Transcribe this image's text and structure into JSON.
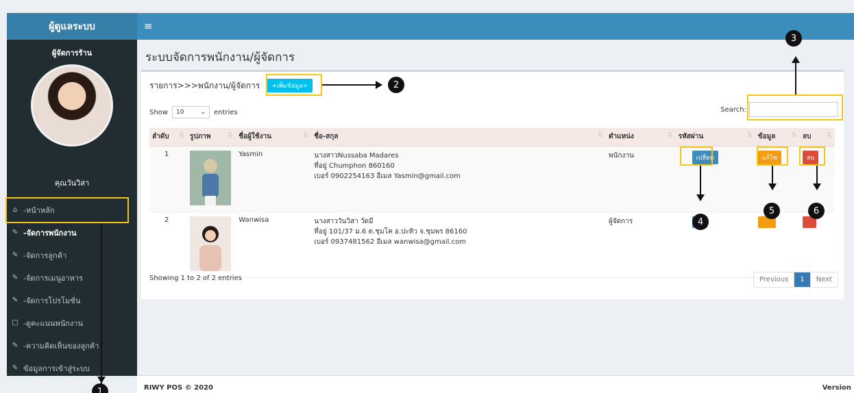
{
  "sidebar": {
    "brand": "ผู้ดูแลระบบ",
    "role": "ผู้จัดการร้าน",
    "user_name": "คุณวันวิสา",
    "items": [
      {
        "label": "-หน้าหลัก",
        "icon": "home-icon"
      },
      {
        "label": "-จัดการพนักงาน",
        "icon": "edit-icon"
      },
      {
        "label": "-จัดการลูกค้า",
        "icon": "edit-icon"
      },
      {
        "label": "-จัดการเมนูอาหาร",
        "icon": "edit-icon"
      },
      {
        "label": "-จัดการโปรโมชั่น",
        "icon": "edit-icon"
      },
      {
        "label": "-ดูคะแนนพนักงาน",
        "icon": "square-icon"
      },
      {
        "label": "-ความคิดเห็นของลูกค้า",
        "icon": "edit-icon"
      },
      {
        "label": "ข้อมูลการเข้าสู่ระบบ",
        "icon": "edit-icon"
      }
    ]
  },
  "topbar": {
    "menu_icon": "≡"
  },
  "main": {
    "title": "ระบบจัดการพนักงาน/ผู้จัดการ",
    "breadcrumb": "รายการ>>>พนักงาน/ผู้จัดการ",
    "add_button": "+เพิ่มข้อมูล+",
    "show_label": "Show",
    "entries_label": "entries",
    "page_size": "10",
    "search_label": "Search:"
  },
  "table": {
    "headers": [
      "ลำดับ",
      "รูปภาพ",
      "ชื่อผู้ใช้งาน",
      "ชื่อ-สกุล",
      "ตำแหน่ง",
      "รหัสผ่าน",
      "ข้อมูล",
      "ลบ"
    ],
    "rows": [
      {
        "no": "1",
        "username": "Yasmin",
        "fullname": "นางสาวNussaba Madares",
        "address": "ที่อยู่ Chumphon 860160",
        "contact": "เบอร์ 0902254163 อีเมล Yasmin@gmail.com",
        "position": "พนักงาน",
        "password_button": "เปลี่ยน",
        "edit_button": "แก้ไข",
        "delete_button": "ลบ"
      },
      {
        "no": "2",
        "username": "Wanwisa",
        "fullname": "นางสาววันวิสา วัดมี",
        "address": "ที่อยู่ 101/37 ม.6 ต.ชุมโค อ.ปะทิว จ.ชุมพร 86160",
        "contact": "เบอร์ 0937481562 อีเมล wanwisa@gmail.com",
        "position": "ผู้จัดการ",
        "password_button": "",
        "edit_button": "",
        "delete_button": ""
      }
    ],
    "info": "Showing 1 to 2 of 2 entries",
    "pagination": {
      "previous": "Previous",
      "current": "1",
      "next": "Next"
    }
  },
  "footer": {
    "copyright": "RIWY POS © 2020",
    "version": "Version"
  },
  "callouts": [
    "1",
    "2",
    "3",
    "4",
    "5",
    "6"
  ],
  "colors": {
    "primary": "#3c8dbc",
    "sidebar": "#222d32",
    "highlight": "#f5c518"
  }
}
